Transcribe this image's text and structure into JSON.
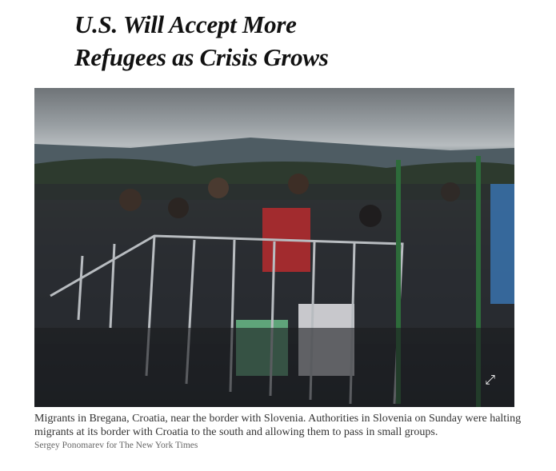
{
  "article": {
    "headline_line1": "U.S. Will Accept More",
    "headline_line2": "Refugees as Crisis Grows",
    "photo": {
      "alt_icon": "expand-icon"
    },
    "caption": "Migrants in Bregana, Croatia, near the border with Slovenia. Authorities in Slovenia on Sunday were halting migrants at its border with Croatia to the south and allowing them to pass in small groups.",
    "credit": "Sergey Ponomarev for The New York Times"
  }
}
